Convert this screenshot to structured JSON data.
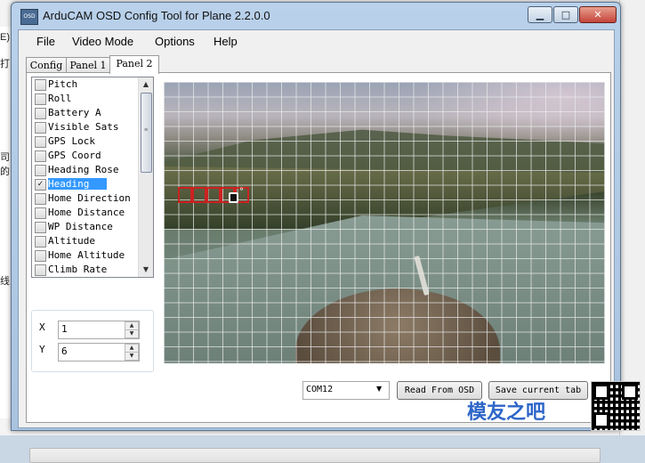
{
  "background": {
    "left_fragments": [
      "E)",
      "打",
      "司的",
      "线"
    ]
  },
  "window": {
    "app_icon_text": "OSD",
    "title": "ArduCAM OSD Config Tool for Plane 2.2.0.0",
    "minimize_glyph": "▁",
    "maximize_glyph": "□",
    "close_glyph": "✕"
  },
  "menu": {
    "file": "File",
    "video_mode": "Video Mode",
    "options": "Options",
    "help": "Help"
  },
  "tabs": [
    {
      "label": "Config",
      "active": false
    },
    {
      "label": "Panel 1",
      "active": false
    },
    {
      "label": "Panel 2",
      "active": true
    }
  ],
  "panel_items": [
    {
      "label": "Pitch",
      "checked": false
    },
    {
      "label": "Roll",
      "checked": false
    },
    {
      "label": "Battery A",
      "checked": false
    },
    {
      "label": "Visible Sats",
      "checked": false
    },
    {
      "label": "GPS Lock",
      "checked": false
    },
    {
      "label": "GPS Coord",
      "checked": false
    },
    {
      "label": "Heading Rose",
      "checked": false
    },
    {
      "label": "Heading",
      "checked": true,
      "selected": true
    },
    {
      "label": "Home Direction",
      "checked": false
    },
    {
      "label": "Home Distance",
      "checked": false
    },
    {
      "label": "WP Distance",
      "checked": false
    },
    {
      "label": "Altitude",
      "checked": false
    },
    {
      "label": "Home Altitude",
      "checked": false
    },
    {
      "label": "Climb Rate",
      "checked": false
    }
  ],
  "check_glyph": "✓",
  "scroll": {
    "up": "▲",
    "down": "▼",
    "grip": "≡"
  },
  "position": {
    "x_label": "X",
    "x_value": "1",
    "y_label": "Y",
    "y_value": "6",
    "spin_up": "▲",
    "spin_down": "▼"
  },
  "osd_preview": {
    "heading_glyph_degree": "°"
  },
  "bottom": {
    "port_value": "COM12",
    "port_arrow": "▼",
    "read_button": "Read From OSD",
    "save_button": "Save current tab"
  },
  "watermark": {
    "text": "模友之吧"
  },
  "colors": {
    "selection": "#3399ff",
    "highlight_box": "#cc2222",
    "watermark": "#2d66c8"
  }
}
